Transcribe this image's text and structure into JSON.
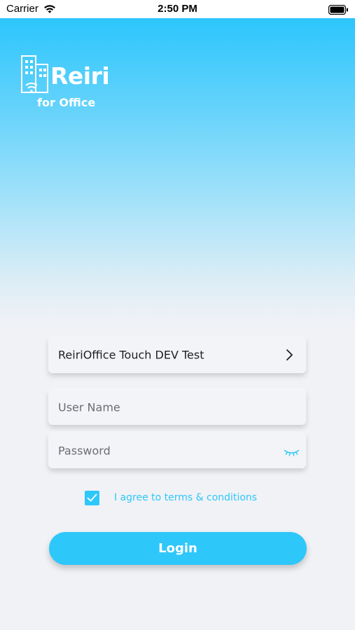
{
  "status_bar": {
    "carrier": "Carrier",
    "time": "2:50 PM",
    "wifi_icon": "wifi-icon",
    "battery_icon": "battery-icon"
  },
  "logo": {
    "brand": "Reiri",
    "subtitle": "for Office",
    "mark_icon": "building-wifi-icon"
  },
  "form": {
    "site_selector": {
      "value": "ReiriOffice Touch DEV Test",
      "icon": "chevron-right-icon"
    },
    "username": {
      "placeholder": "User Name",
      "value": ""
    },
    "password": {
      "placeholder": "Password",
      "value": "",
      "visibility_icon": "eye-closed-icon"
    },
    "terms": {
      "checked": true,
      "label": "I agree to terms & conditions"
    },
    "login_label": "Login"
  },
  "colors": {
    "accent": "#2ec7fa",
    "hero_top": "#2cc6fc",
    "background": "#f1f2f6"
  }
}
